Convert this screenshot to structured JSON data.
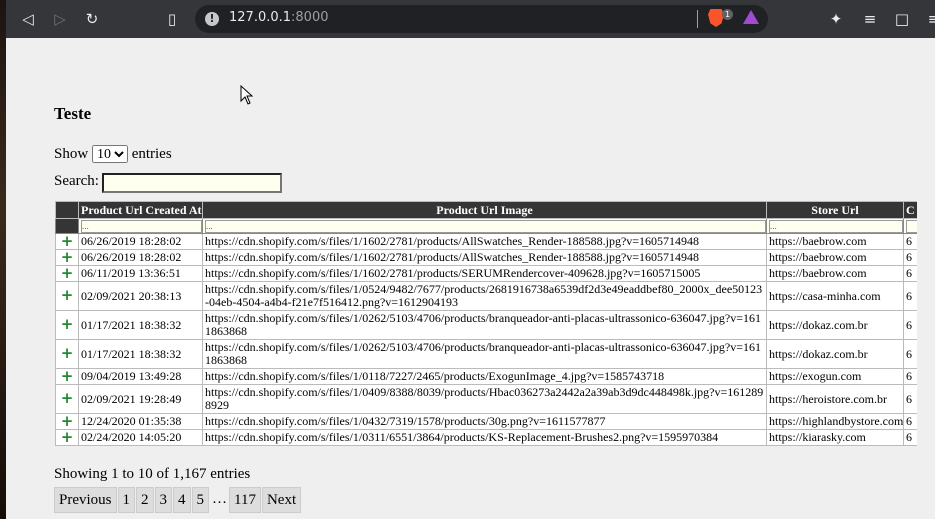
{
  "browser": {
    "url_host": "127.0.0.1",
    "url_port": ":8000",
    "shields_count": "1"
  },
  "page": {
    "title": "Teste",
    "length_label_before": "Show",
    "length_value": "10",
    "length_label_after": "entries",
    "search_label": "Search:",
    "search_value": ""
  },
  "table": {
    "columns": [
      "",
      "Product Url Created At",
      "Product Url Image",
      "Store Url",
      "C"
    ],
    "filter_placeholder": "...",
    "rows": [
      {
        "created": "06/26/2019 18:28:02",
        "image": "https://cdn.shopify.com/s/files/1/1602/2781/products/AllSwatches_Render-188588.jpg?v=1605714948",
        "store": "https://baebrow.com",
        "c": "6"
      },
      {
        "created": "06/26/2019 18:28:02",
        "image": "https://cdn.shopify.com/s/files/1/1602/2781/products/AllSwatches_Render-188588.jpg?v=1605714948",
        "store": "https://baebrow.com",
        "c": "6"
      },
      {
        "created": "06/11/2019 13:36:51",
        "image": "https://cdn.shopify.com/s/files/1/1602/2781/products/SERUMRendercover-409628.jpg?v=1605715005",
        "store": "https://baebrow.com",
        "c": "6"
      },
      {
        "created": "02/09/2021 20:38:13",
        "image": "https://cdn.shopify.com/s/files/1/0524/9482/7677/products/2681916738a6539df2d3e49eaddbef80_2000x_dee50123-04eb-4504-a4b4-f21e7f516412.png?v=1612904193",
        "store": "https://casa-minha.com",
        "c": "6"
      },
      {
        "created": "01/17/2021 18:38:32",
        "image": "https://cdn.shopify.com/s/files/1/0262/5103/4706/products/branqueador-anti-placas-ultrassonico-636047.jpg?v=1611863868",
        "store": "https://dokaz.com.br",
        "c": "6"
      },
      {
        "created": "01/17/2021 18:38:32",
        "image": "https://cdn.shopify.com/s/files/1/0262/5103/4706/products/branqueador-anti-placas-ultrassonico-636047.jpg?v=1611863868",
        "store": "https://dokaz.com.br",
        "c": "6"
      },
      {
        "created": "09/04/2019 13:49:28",
        "image": "https://cdn.shopify.com/s/files/1/0118/7227/2465/products/ExogunImage_4.jpg?v=1585743718",
        "store": "https://exogun.com",
        "c": "6"
      },
      {
        "created": "02/09/2021 19:28:49",
        "image": "https://cdn.shopify.com/s/files/1/0409/8388/8039/products/Hbac036273a2442a2a39ab3d9dc448498k.jpg?v=1612898929",
        "store": "https://heroistore.com.br",
        "c": "6"
      },
      {
        "created": "12/24/2020 01:35:38",
        "image": "https://cdn.shopify.com/s/files/1/0432/7319/1578/products/30g.png?v=1611577877",
        "store": "https://highlandbystore.com",
        "c": "6"
      },
      {
        "created": "02/24/2020 14:05:20",
        "image": "https://cdn.shopify.com/s/files/1/0311/6551/3864/products/KS-Replacement-Brushes2.png?v=1595970384",
        "store": "https://kiarasky.com",
        "c": "6"
      }
    ]
  },
  "footer": {
    "info": "Showing 1 to 10 of 1,167 entries",
    "pager": {
      "previous": "Previous",
      "pages": [
        "1",
        "2",
        "3",
        "4",
        "5"
      ],
      "ellipsis": "…",
      "last": "117",
      "next": "Next"
    }
  }
}
